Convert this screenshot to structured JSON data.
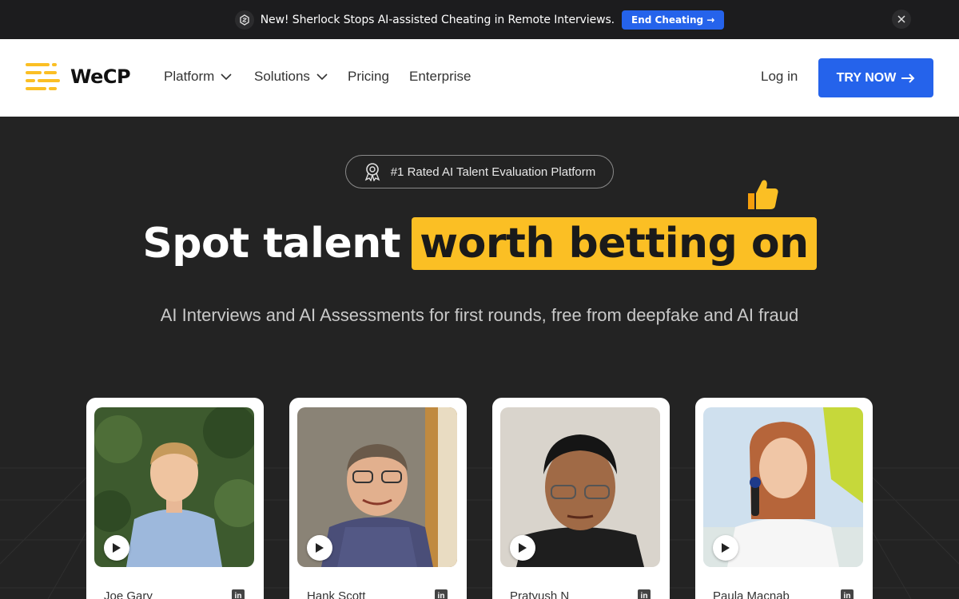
{
  "announcement": {
    "text": "New! Sherlock Stops AI-assisted Cheating in Remote Interviews.",
    "cta": "End Cheating →"
  },
  "nav": {
    "brand": "WeCP",
    "items": [
      {
        "label": "Platform",
        "dropdown": true
      },
      {
        "label": "Solutions",
        "dropdown": true
      },
      {
        "label": "Pricing",
        "dropdown": false
      },
      {
        "label": "Enterprise",
        "dropdown": false
      }
    ],
    "login": "Log in",
    "try_now": "TRY NOW"
  },
  "hero": {
    "badge": "#1 Rated AI Talent Evaluation Platform",
    "headline_plain": "Spot talent",
    "headline_highlight": "worth betting on",
    "subheadline": "AI Interviews and AI Assessments for first rounds, free from deepfake and AI fraud"
  },
  "cards": [
    {
      "name": "Joe Gary"
    },
    {
      "name": "Hank Scott"
    },
    {
      "name": "Pratyush N"
    },
    {
      "name": "Paula Macnab"
    }
  ],
  "colors": {
    "accent_blue": "#2563eb",
    "highlight_yellow": "#fbbf24",
    "hero_bg": "#232323"
  }
}
